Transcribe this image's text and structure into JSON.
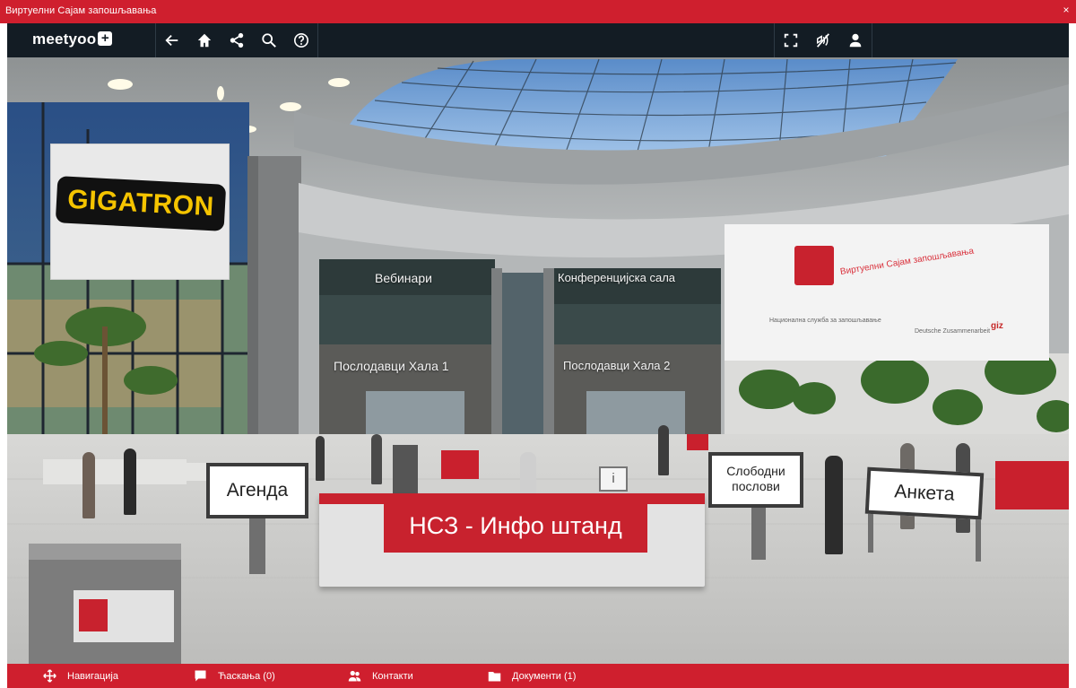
{
  "window": {
    "title": "Виртуелни Сајам запошљавања",
    "close_label": "×"
  },
  "toolbar": {
    "logo_text": "meetyoo",
    "logo_mark": "+",
    "buttons": [
      {
        "name": "back-arrow-icon"
      },
      {
        "name": "home-icon"
      },
      {
        "name": "share-icon"
      },
      {
        "name": "search-icon"
      },
      {
        "name": "help-icon"
      }
    ],
    "right_buttons": [
      {
        "name": "fullscreen-icon"
      },
      {
        "name": "mute-icon"
      },
      {
        "name": "user-icon"
      }
    ]
  },
  "scene": {
    "sponsor_logo": "GIGATRON",
    "wall_labels": {
      "webinars": "Вебинари",
      "conference": "Конференцијска сала",
      "hall1": "Послодавци Хала 1",
      "hall2": "Послодавци Хала 2"
    },
    "banner": {
      "line1": "Виртуелни Сајам запошљавања",
      "line2": "Национална служба за запошљавање",
      "line3": "Deutsche Zusammenarbeit",
      "logo": "giz"
    },
    "signs": {
      "agenda": "Агенда",
      "jobs_line1": "Слободни",
      "jobs_line2": "послови",
      "survey": "Анкета",
      "info_stand": "НСЗ - Инфо штанд"
    },
    "colors": {
      "accent": "#cf1f2e",
      "toolbar": "#131c24"
    }
  },
  "bottombar": {
    "items": [
      {
        "label": "Навигација",
        "icon": "navigation-icon"
      },
      {
        "label": "Ћаскања (0)",
        "icon": "chat-icon"
      },
      {
        "label": "Контакти",
        "icon": "contacts-icon"
      },
      {
        "label": "Документи (1)",
        "icon": "folder-icon"
      }
    ]
  }
}
